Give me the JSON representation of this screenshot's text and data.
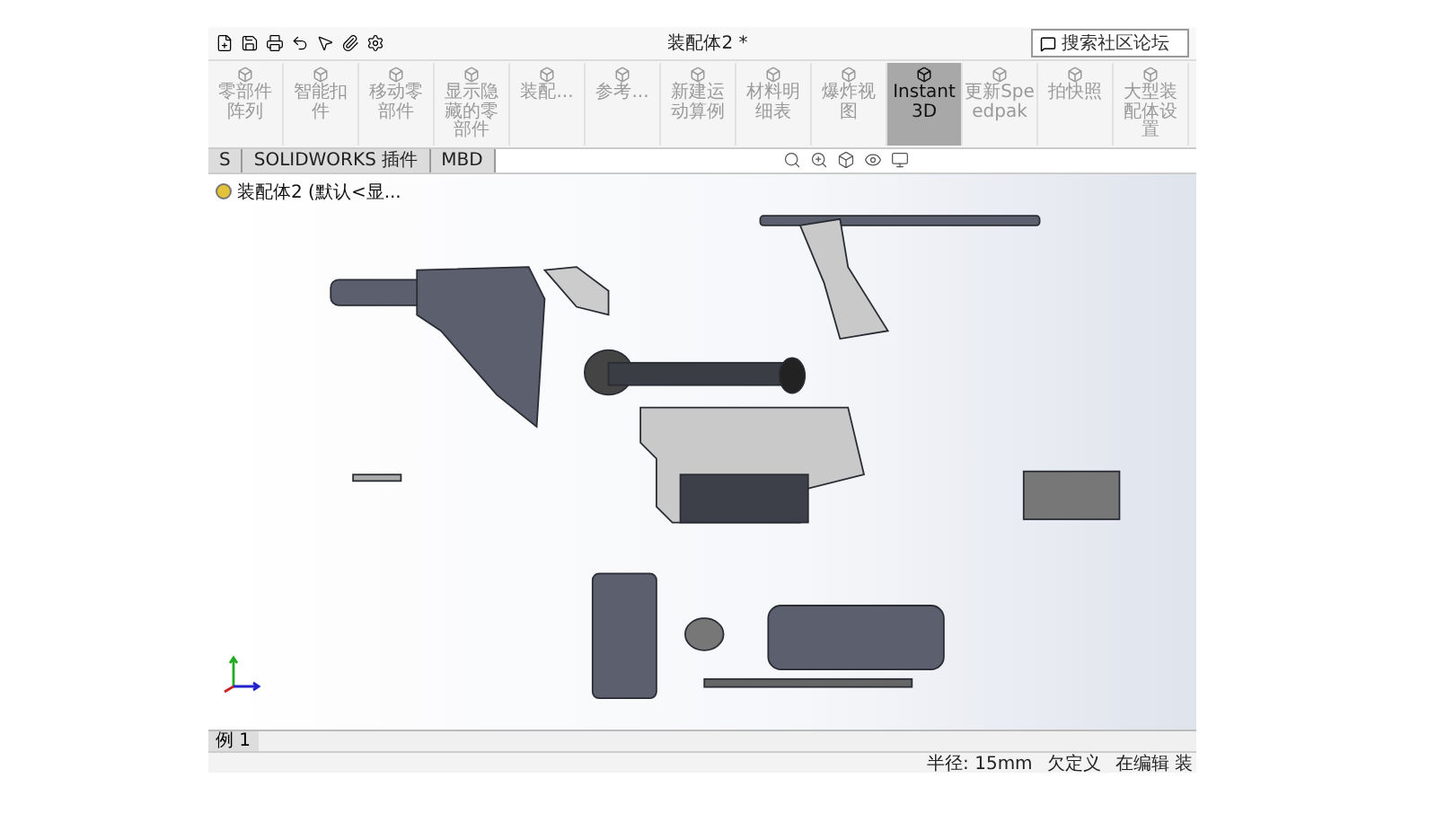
{
  "window": {
    "title": "装配体2 *"
  },
  "search": {
    "placeholder": "搜索社区论坛"
  },
  "ribbon": [
    {
      "label": "零部件阵列",
      "selected": false
    },
    {
      "label": "智能扣件",
      "selected": false
    },
    {
      "label": "移动零部件",
      "selected": false
    },
    {
      "label": "显示隐藏的零部件",
      "selected": false
    },
    {
      "label": "装配...",
      "selected": false
    },
    {
      "label": "参考...",
      "selected": false
    },
    {
      "label": "新建运动算例",
      "selected": false
    },
    {
      "label": "材料明细表",
      "selected": false
    },
    {
      "label": "爆炸视图",
      "selected": false
    },
    {
      "label": "Instant3D",
      "selected": true
    },
    {
      "label": "更新Speedpak",
      "selected": false
    },
    {
      "label": "拍快照",
      "selected": false
    },
    {
      "label": "大型装配体设置",
      "selected": false
    }
  ],
  "tabs": [
    {
      "label": "S",
      "selected": false
    },
    {
      "label": "SOLIDWORKS 插件",
      "selected": false
    },
    {
      "label": "MBD",
      "selected": false
    }
  ],
  "tree": {
    "root": "装配体2 (默认<显..."
  },
  "bottom_tabs": [
    {
      "label": "例 1",
      "selected": true
    }
  ],
  "status_bar": [
    "半径: 15mm",
    "欠定义",
    "在编辑 装"
  ]
}
